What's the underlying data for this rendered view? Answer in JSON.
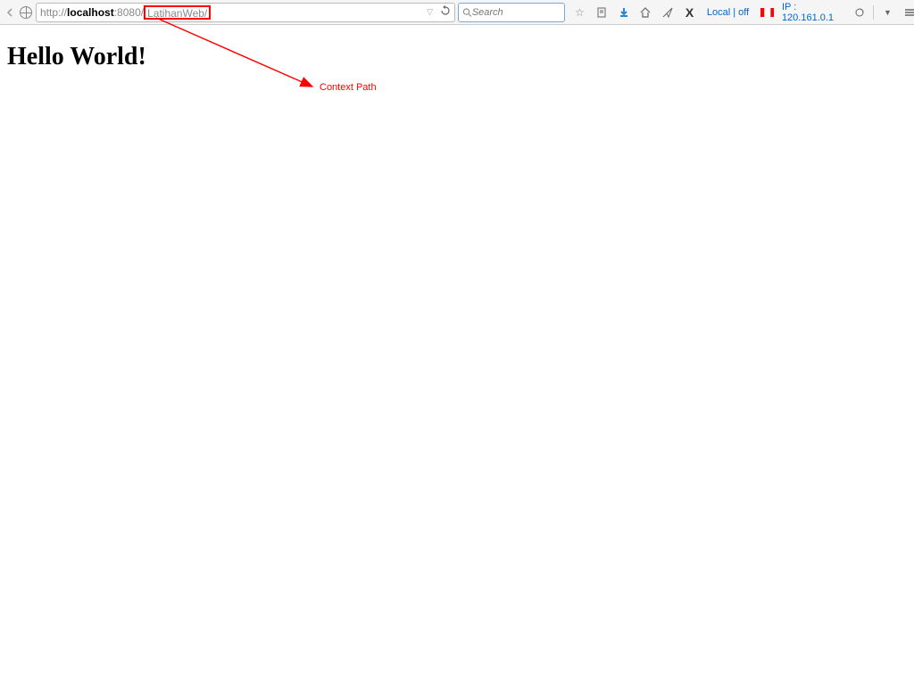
{
  "toolbar": {
    "url_prefix": "http://",
    "url_host": "localhost",
    "url_port": ":8080/",
    "url_path": "LatihanWeb/",
    "search_placeholder": "Search",
    "status_text": "Local | off",
    "ip_label": "IP : 120.161.0.1"
  },
  "page": {
    "heading": "Hello World!"
  },
  "annotation": {
    "label": "Context Path"
  }
}
